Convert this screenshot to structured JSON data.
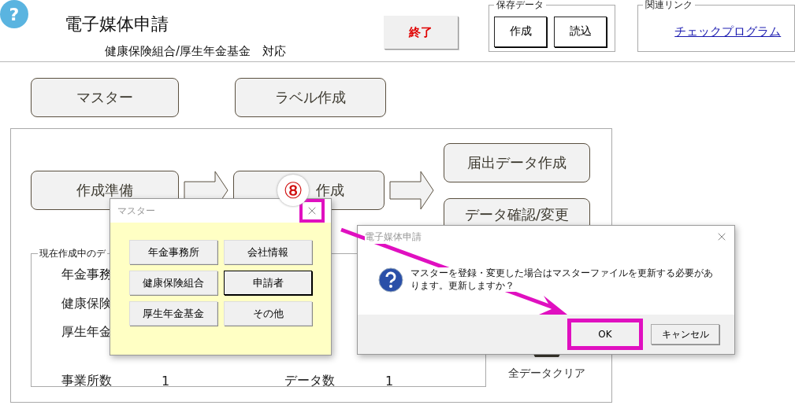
{
  "app": {
    "help_icon": "?",
    "title": "電子媒体申請",
    "subtitle": "健康保険組合/厚生年金基金　対応",
    "exit_button": "終了",
    "save_group": {
      "legend": "保存データ",
      "buttons": [
        "作成",
        "読込"
      ]
    },
    "links_group": {
      "legend": "関連リンク",
      "link": "チェックプログラム"
    }
  },
  "menu_buttons": [
    "マスター",
    "ラベル作成"
  ],
  "steps": {
    "prepare": "作成準備",
    "create": "作成",
    "right": [
      "届出データ作成",
      "データ確認/変更"
    ]
  },
  "current_data": {
    "legend": "現在作成中のデ",
    "labels": [
      "年金事務",
      "健康保険",
      "厚生年金"
    ],
    "office_count_label": "事業所数",
    "office_count": "1",
    "data_count_label": "データ数",
    "data_count": "1"
  },
  "clear_all": "全データクリア",
  "step_badge": "⑧",
  "master_dialog": {
    "title": "マスター",
    "close_highlighted": true,
    "buttons": [
      {
        "label": "年金事務所",
        "focused": false
      },
      {
        "label": "会社情報",
        "focused": false
      },
      {
        "label": "健康保険組合",
        "focused": false
      },
      {
        "label": "申請者",
        "focused": true
      },
      {
        "label": "厚生年金基金",
        "focused": false
      },
      {
        "label": "その他",
        "focused": false
      }
    ]
  },
  "message_dialog": {
    "title": "電子媒体申請",
    "message": "マスターを登録・変更した場合はマスターファイルを更新する必要があります。更新しますか？",
    "buttons": [
      {
        "label": "OK",
        "highlighted": true
      },
      {
        "label": "キャンセル",
        "highlighted": false
      }
    ]
  }
}
